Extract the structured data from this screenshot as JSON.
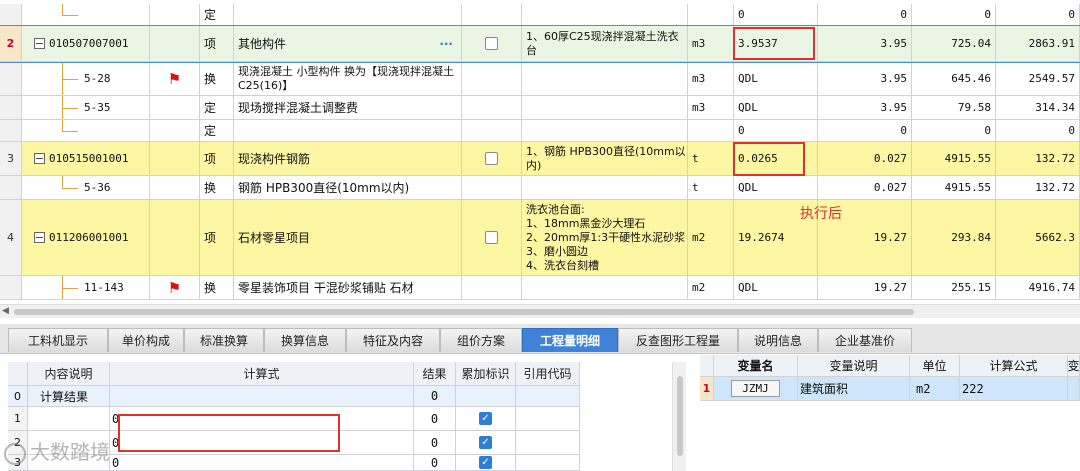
{
  "grid": {
    "rows": [
      {
        "num": "",
        "code": "",
        "type": "定",
        "name": "",
        "feature": "",
        "unit": "",
        "expr": "0",
        "qty": "0",
        "price": "0",
        "total": "0"
      },
      {
        "num": "2",
        "code": "010507007001",
        "type": "项",
        "name": "其他构件",
        "feature": "1、60厚C25现浇拌混凝土洗衣台",
        "unit": "m3",
        "expr": "3.9537",
        "qty": "3.95",
        "price": "725.04",
        "total": "2863.91"
      },
      {
        "num": "",
        "code": "5-28",
        "type": "换",
        "name": "现浇混凝土 小型构件  换为【现浇现拌混凝土C25(16)】",
        "feature": "",
        "unit": "m3",
        "expr": "QDL",
        "qty": "3.95",
        "price": "645.46",
        "total": "2549.57"
      },
      {
        "num": "",
        "code": "5-35",
        "type": "定",
        "name": "现场搅拌混凝土调整费",
        "feature": "",
        "unit": "m3",
        "expr": "QDL",
        "qty": "3.95",
        "price": "79.58",
        "total": "314.34"
      },
      {
        "num": "",
        "code": "",
        "type": "定",
        "name": "",
        "feature": "",
        "unit": "",
        "expr": "0",
        "qty": "0",
        "price": "0",
        "total": "0"
      },
      {
        "num": "3",
        "code": "010515001001",
        "type": "项",
        "name": "现浇构件钢筋",
        "feature": "1、钢筋  HPB300直径(10mm以内)",
        "unit": "t",
        "expr": "0.0265",
        "qty": "0.027",
        "price": "4915.55",
        "total": "132.72"
      },
      {
        "num": "",
        "code": "5-36",
        "type": "换",
        "name": "钢筋  HPB300直径(10mm以内)",
        "feature": "",
        "unit": "t",
        "expr": "QDL",
        "qty": "0.027",
        "price": "4915.55",
        "total": "132.72"
      },
      {
        "num": "4",
        "code": "011206001001",
        "type": "项",
        "name": "石材零星项目",
        "feature": "洗衣池台面:\n1、18mm黑金沙大理石\n2、20mm厚1:3干硬性水泥砂浆\n3、磨小圆边\n4、洗衣台刻槽",
        "unit": "m2",
        "expr": "19.2674",
        "qty": "19.27",
        "price": "293.84",
        "total": "5662.3"
      },
      {
        "num": "",
        "code": "11-143",
        "type": "换",
        "name": "零星装饰项目 干混砂浆铺贴 石材",
        "feature": "",
        "unit": "m2",
        "expr": "QDL",
        "qty": "19.27",
        "price": "255.15",
        "total": "4916.74"
      }
    ],
    "annotation": "执行后"
  },
  "tabs": [
    "工料机显示",
    "单价构成",
    "标准换算",
    "换算信息",
    "特征及内容",
    "组价方案",
    "工程量明细",
    "反查图形工程量",
    "说明信息",
    "企业基准价"
  ],
  "active_tab": "工程量明细",
  "detail_table": {
    "headers": [
      "内容说明",
      "计算式",
      "结果",
      "累加标识",
      "引用代码"
    ],
    "rows": [
      {
        "idx": "0",
        "desc": "计算结果",
        "formula": "",
        "result": "0",
        "checked": false
      },
      {
        "idx": "1",
        "desc": "",
        "formula": "0",
        "result": "0",
        "checked": true
      },
      {
        "idx": "2",
        "desc": "",
        "formula": "0",
        "result": "0",
        "checked": true
      },
      {
        "idx": "3",
        "desc": "",
        "formula": "0",
        "result": "0",
        "checked": true
      }
    ]
  },
  "var_table": {
    "headers": [
      "变量名",
      "变量说明",
      "单位",
      "计算公式",
      "变"
    ],
    "rows": [
      {
        "idx": "1",
        "name": "JZMJ",
        "desc": "建筑面积",
        "unit": "m2",
        "formula": "222"
      }
    ]
  },
  "watermark": "大数踏境",
  "colors": {
    "highlight_row": "#fdf6a3",
    "selected_row": "#eaf6e3",
    "active_tab": "#3f82d8",
    "red_box": "#e03030"
  }
}
